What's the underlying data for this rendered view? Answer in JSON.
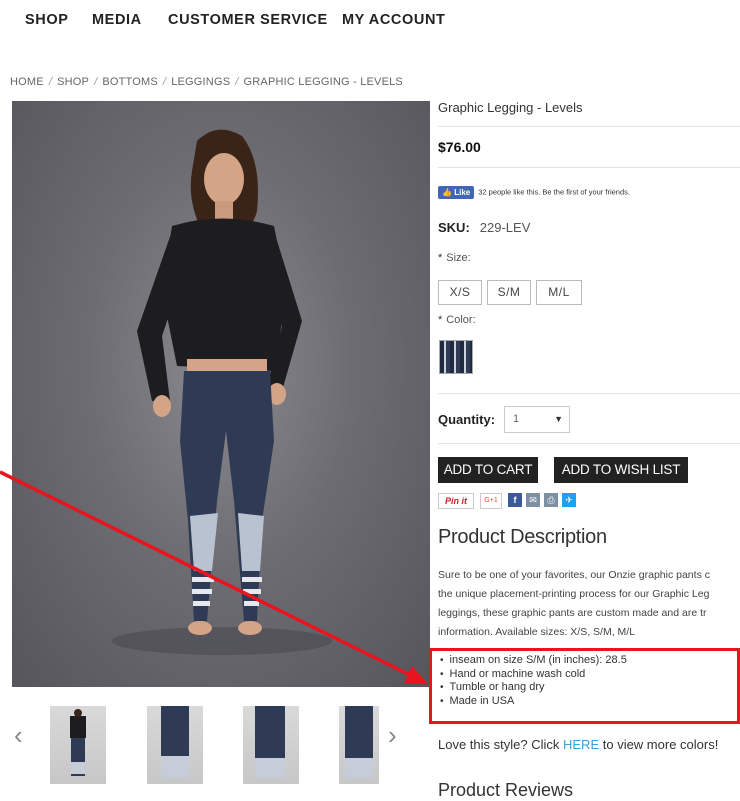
{
  "nav": {
    "shop": "SHOP",
    "media": "MEDIA",
    "customer_service": "CUSTOMER SERVICE",
    "my_account": "MY ACCOUNT"
  },
  "breadcrumb": [
    "HOME",
    "SHOP",
    "BOTTOMS",
    "LEGGINGS",
    "GRAPHIC LEGGING - LEVELS"
  ],
  "breadcrumb_sep": "/",
  "product": {
    "title": "Graphic Legging - Levels",
    "price": "$76.00",
    "fb_like_label": "Like",
    "fb_like_text": "32 people like this. Be the first of your friends.",
    "sku_label": "SKU:",
    "sku_value": "229-LEV",
    "size_label": "Size:",
    "sizes": [
      "X/S",
      "S/M",
      "M/L"
    ],
    "color_label": "Color:",
    "required_mark": "*",
    "quantity_label": "Quantity:",
    "quantity_value": "1",
    "add_to_cart": "ADD TO CART",
    "add_to_wishlist": "ADD TO WISH LIST",
    "social": {
      "pinit": "Pin it",
      "gplus": "G+1"
    },
    "description_title": "Product Description",
    "description_lines": [
      "Sure to be one of your favorites, our Onzie graphic pants c",
      "the unique placement-printing process for our Graphic Leg",
      "leggings, these graphic pants are custom made and are tr",
      "information. Available sizes: X/S, S/M, M/L"
    ],
    "details": [
      "inseam on size S/M (in inches): 28.5",
      "Hand or machine wash cold",
      "Tumble or hang dry",
      "Made in USA"
    ],
    "love_prefix": "Love this style? Click ",
    "love_link": "HERE",
    "love_suffix": " to view more colors!",
    "reviews_title": "Product Reviews"
  },
  "thumbnails_count": 4,
  "colors": {
    "annotation_red": "#e8141e",
    "button_bg": "#222222",
    "link_blue": "#3aa0d8",
    "facebook": "#4267b2"
  }
}
